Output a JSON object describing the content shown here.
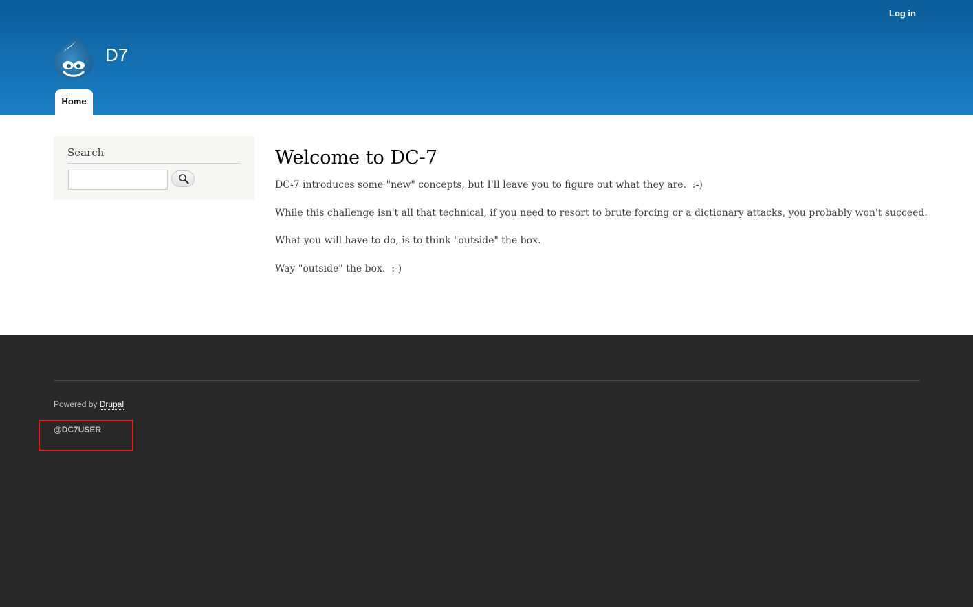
{
  "header": {
    "site_name": "D7",
    "login_label": "Log in",
    "logo_icon": "drupal-drop-icon",
    "tabs": [
      {
        "label": "Home",
        "active": true
      }
    ],
    "colors": {
      "gradient_top": "#0a5d98",
      "gradient_bottom": "#1a80c7"
    }
  },
  "sidebar": {
    "search_block": {
      "title": "Search",
      "input_value": "",
      "button_icon": "magnifier-icon"
    }
  },
  "main": {
    "title": "Welcome to DC-7",
    "paragraphs": [
      "DC-7 introduces some \"new\" concepts, but I'll leave you to figure out what they are.  :-)",
      "While this challenge isn't all that technical, if you need to resort to brute forcing or a dictionary attacks, you probably won't succeed.",
      "What you will have to do, is to think \"outside\" the box.",
      "Way \"outside\" the box.  :-)"
    ]
  },
  "footer": {
    "powered_by_prefix": "Powered by ",
    "powered_by_link": "Drupal",
    "user_handle": "@DC7USER",
    "highlight_color": "#e02020",
    "background_color": "#292929"
  }
}
